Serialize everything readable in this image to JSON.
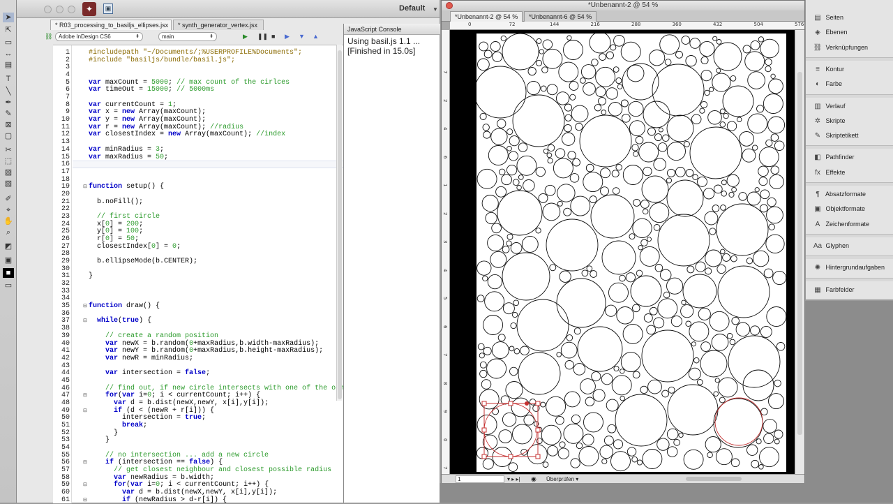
{
  "workspace": {
    "label": "Default"
  },
  "estk": {
    "tabs": [
      "* R03_processing_to_basiljs_ellipses.jsx",
      "* synth_generator_vertex.jsx"
    ],
    "target_app": "Adobe InDesign CS6",
    "function_select": "main",
    "lines": [
      "#includepath \"~/Documents/;%USERPROFILE%Documents\";",
      "#include \"basiljs/bundle/basil.js\";",
      "",
      "",
      "var maxCount = 5000; // max count of the cirlces",
      "var timeOut = 15000; // 5000ms",
      "",
      "var currentCount = 1;",
      "var x = new Array(maxCount);",
      "var y = new Array(maxCount);",
      "var r = new Array(maxCount); //radius",
      "var closestIndex = new Array(maxCount); //index",
      "",
      "var minRadius = 3;",
      "var maxRadius = 50;",
      "",
      "",
      "",
      "function setup() {",
      "",
      "  b.noFill();",
      "",
      "  // first circle",
      "  x[0] = 200;",
      "  y[0] = 100;",
      "  r[0] = 50;",
      "  closestIndex[0] = 0;",
      "",
      "  b.ellipseMode(b.CENTER);",
      "",
      "}",
      "",
      "",
      "",
      "function draw() {",
      "",
      "  while(true) {",
      "",
      "    // create a random position",
      "    var newX = b.random(0+maxRadius,b.width-maxRadius);",
      "    var newY = b.random(0+maxRadius,b.height-maxRadius);",
      "    var newR = minRadius;",
      "",
      "    var intersection = false;",
      "",
      "    // find out, if new circle intersects with one of the oth",
      "    for(var i=0; i < currentCount; i++) {",
      "      var d = b.dist(newX,newY, x[i],y[i]);",
      "      if (d < (newR + r[i])) {",
      "        intersection = true;",
      "        break;",
      "      }",
      "    }",
      "",
      "    // no intersection ... add a new circle",
      "    if (intersection == false) {",
      "      // get closest neighbour and closest possible radius",
      "      var newRadius = b.width;",
      "      for(var i=0; i < currentCount; i++) {",
      "        var d = b.dist(newX,newY, x[i],y[i]);",
      "        if (newRadius > d-r[i]) {"
    ]
  },
  "console": {
    "title": "JavaScript Console",
    "lines": [
      "Using basil.js 1.1 ...",
      "[Finished in 15.0s]"
    ]
  },
  "indesign": {
    "window_title": "*Unbenannt-2 @ 54 %",
    "tabs": [
      "*Unbenannt-2 @ 54 %",
      "*Unbenannt-6 @ 54 %"
    ],
    "hruler_labels": [
      "0",
      "72",
      "144",
      "216",
      "288",
      "360",
      "432",
      "504",
      "576"
    ],
    "vruler_labels": [
      "7",
      "2",
      "4",
      "6",
      "1",
      "2",
      "3",
      "4",
      "5",
      "6",
      "7",
      "8",
      "9",
      "0",
      "7"
    ],
    "page_number": "1",
    "preflight": "Überprüfen"
  },
  "panels": [
    {
      "label": "Seiten",
      "icon": "pages-icon"
    },
    {
      "label": "Ebenen",
      "icon": "layers-icon"
    },
    {
      "label": "Verknüpfungen",
      "icon": "links-icon"
    },
    {
      "label": "Kontur",
      "icon": "stroke-icon"
    },
    {
      "label": "Farbe",
      "icon": "color-icon"
    },
    {
      "label": "Verlauf",
      "icon": "gradient-icon"
    },
    {
      "label": "Skripte",
      "icon": "scripts-icon"
    },
    {
      "label": "Skriptetikett",
      "icon": "script-label-icon"
    },
    {
      "label": "Pathfinder",
      "icon": "pathfinder-icon"
    },
    {
      "label": "Effekte",
      "icon": "effects-icon"
    },
    {
      "label": "Absatzformate",
      "icon": "paragraph-styles-icon"
    },
    {
      "label": "Objektformate",
      "icon": "object-styles-icon"
    },
    {
      "label": "Zeichenformate",
      "icon": "character-styles-icon"
    },
    {
      "label": "Glyphen",
      "icon": "glyphs-icon"
    },
    {
      "label": "Hintergrundaufgaben",
      "icon": "background-tasks-icon"
    },
    {
      "label": "Farbfelder",
      "icon": "swatches-icon"
    }
  ],
  "colors": {
    "keyword": "#0000c8",
    "comment": "#2a9a2a",
    "string": "#8a6a00",
    "number": "#2a9a2a",
    "selection": "#c43030"
  }
}
